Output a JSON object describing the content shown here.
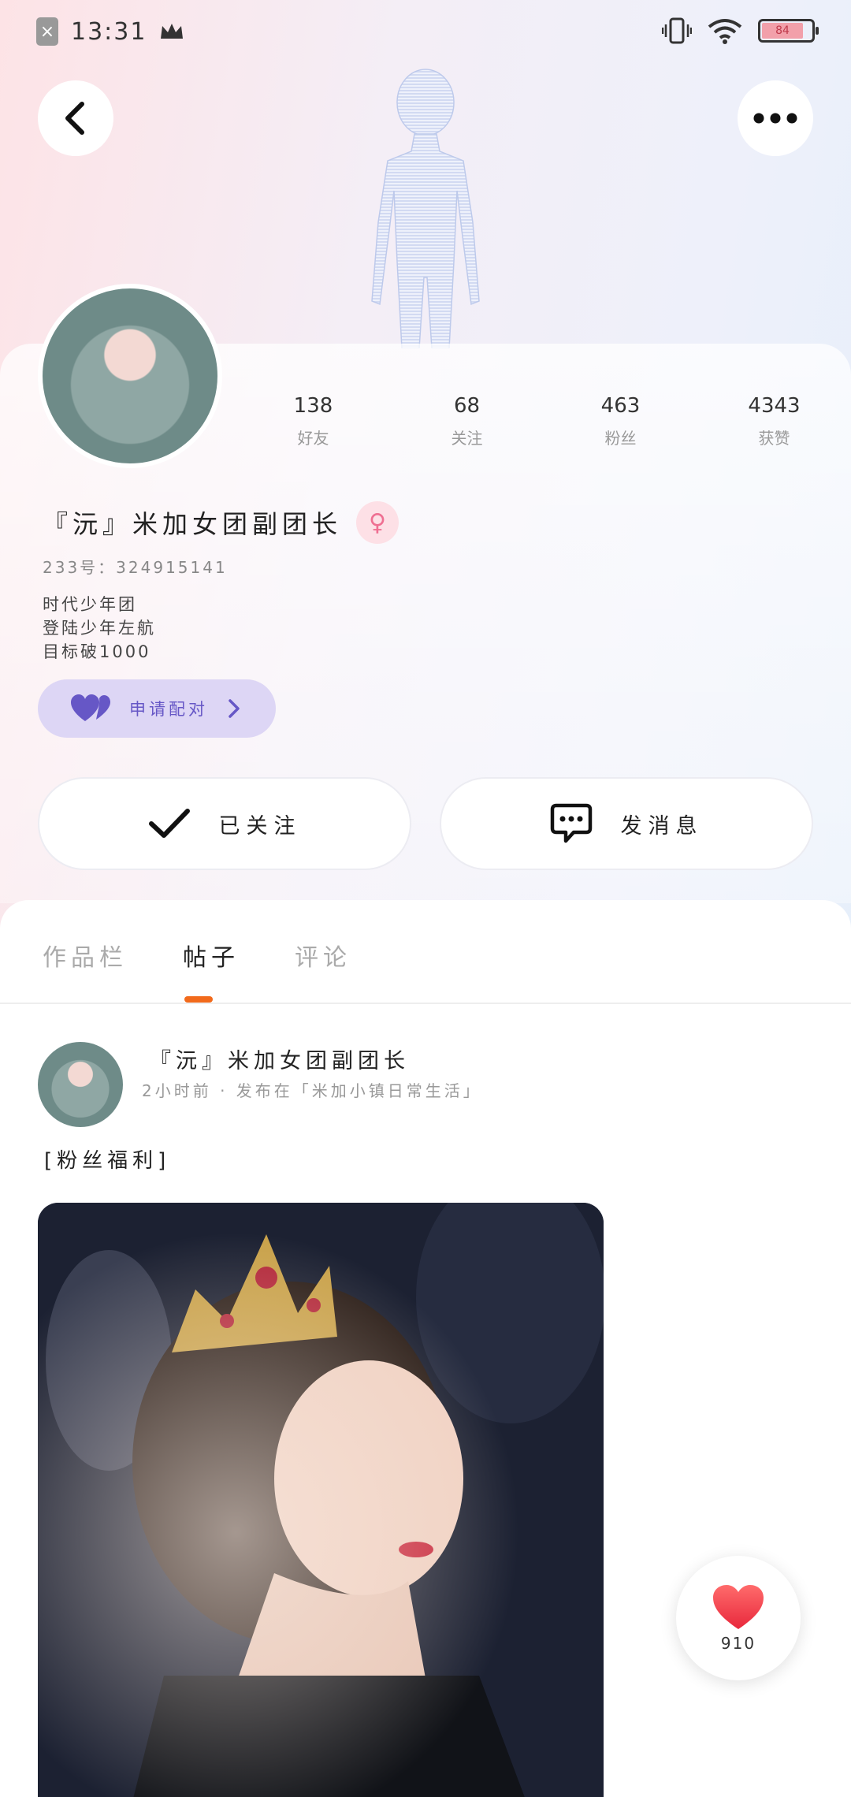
{
  "status_bar": {
    "time": "13:31",
    "battery": "84",
    "icons": [
      "close-notification-icon",
      "crown-icon",
      "vibrate-icon",
      "wifi-icon",
      "battery-icon"
    ]
  },
  "header": {
    "back_icon": "chevron-left-icon",
    "more_icon": "more-dots-icon"
  },
  "profile": {
    "stats": [
      {
        "value": "138",
        "label": "好友"
      },
      {
        "value": "68",
        "label": "关注"
      },
      {
        "value": "463",
        "label": "粉丝"
      },
      {
        "value": "4343",
        "label": "获赞"
      }
    ],
    "name": "『沅』米加女团副团长",
    "gender_icon": "female-icon",
    "uid": "233号：324915141",
    "bio_lines": [
      "时代少年团",
      "登陆少年左航",
      "目标破1000"
    ],
    "pair_button": "申请配对",
    "follow_button": "已关注",
    "message_button": "发消息"
  },
  "tabs": [
    {
      "label": "作品栏",
      "active": false
    },
    {
      "label": "帖子",
      "active": true
    },
    {
      "label": "评论",
      "active": false
    }
  ],
  "post": {
    "author": "『沅』米加女团副团长",
    "meta": "2小时前 · 发布在「米加小镇日常生活」",
    "text": "[粉丝福利]"
  },
  "like_button": {
    "count": "910",
    "icon": "heart-icon"
  },
  "colors": {
    "accent_orange": "#f26a1b",
    "pair_bg": "#ddd6f5",
    "pair_text": "#6657c6",
    "heart_red": "#f0434f",
    "gender_pink": "#ef6f92"
  }
}
